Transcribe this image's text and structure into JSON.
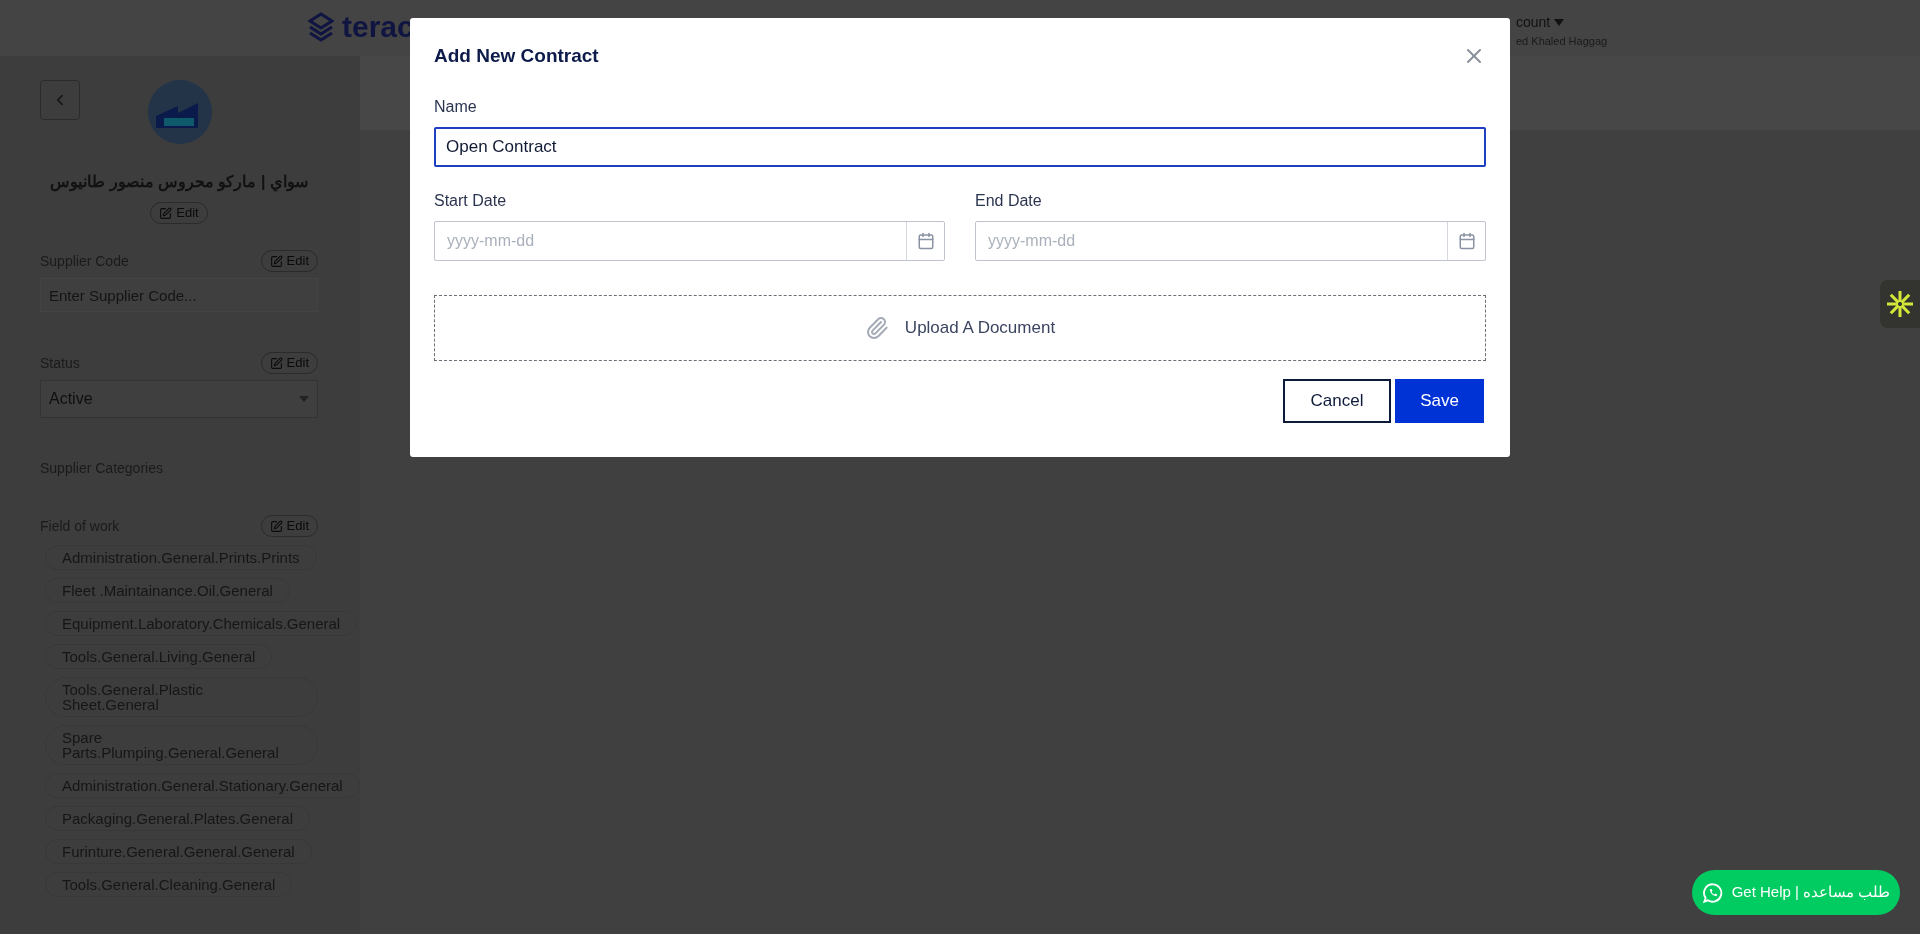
{
  "header": {
    "logo_text": "terac",
    "account_label": "count",
    "account_name": "ed Khaled Haggag"
  },
  "sidebar": {
    "supplier_name": "سواي | ماركو محروس منصور طانيوس",
    "name_edit": "Edit",
    "supplier_code": {
      "label": "Supplier Code",
      "edit": "Edit",
      "placeholder": "Enter Supplier Code..."
    },
    "status": {
      "label": "Status",
      "edit": "Edit",
      "value": "Active"
    },
    "categories_label": "Supplier Categories",
    "field_of_work": {
      "label": "Field of work",
      "edit": "Edit",
      "tags": [
        "Administration.General.Prints.Prints",
        "Fleet .Maintainance.Oil.General",
        "Equipment.Laboratory.Chemicals.General",
        "Tools.General.Living.General",
        "Tools.General.Plastic Sheet.General",
        "Spare Parts.Plumping.General.General",
        "Administration.General.Stationary.General",
        "Packaging.General.Plates.General",
        "Furinture.General.General.General",
        "Tools.General.Cleaning.General"
      ]
    }
  },
  "modal": {
    "title": "Add New Contract",
    "name_label": "Name",
    "name_value": "Open Contract",
    "start_date": {
      "label": "Start Date",
      "placeholder": "yyyy-mm-dd"
    },
    "end_date": {
      "label": "End Date",
      "placeholder": "yyyy-mm-dd"
    },
    "upload": "Upload A Document",
    "cancel": "Cancel",
    "save": "Save"
  },
  "help_button": "Get Help | طلب مساعده"
}
